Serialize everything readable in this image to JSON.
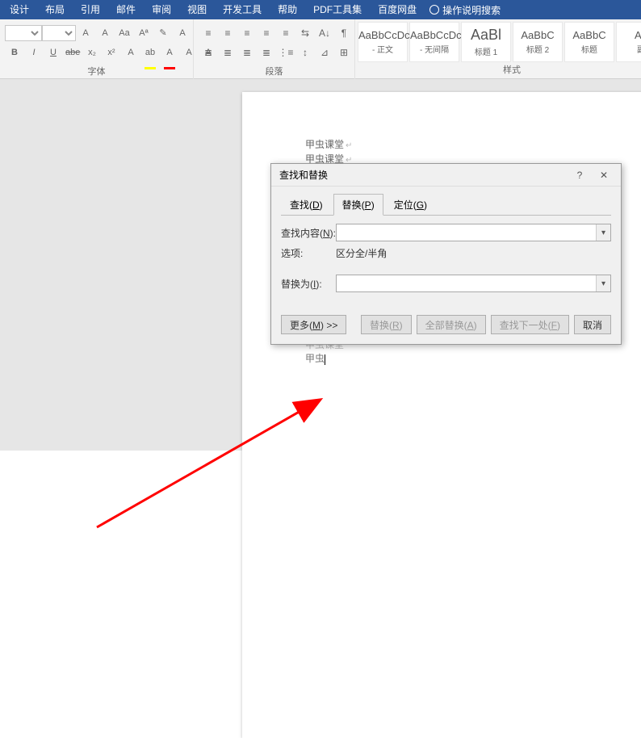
{
  "menu": {
    "items": [
      "设计",
      "布局",
      "引用",
      "邮件",
      "审阅",
      "视图",
      "开发工具",
      "帮助",
      "PDF工具集",
      "百度网盘"
    ],
    "search_hint": "操作说明搜索"
  },
  "ribbon": {
    "font": {
      "label": "字体",
      "btns_row1": [
        "A",
        "A",
        "Aa",
        "Aª",
        "✎",
        "A"
      ],
      "btns_row2": [
        "B",
        "I",
        "U",
        "abe",
        "x₂",
        "x²",
        "A",
        "ab",
        "A",
        "A",
        "A"
      ]
    },
    "paragraph": {
      "label": "段落",
      "btns_row1": [
        "≡",
        "≡",
        "≡",
        "≡",
        "≡",
        "⇆",
        "A↓",
        "¶"
      ],
      "btns_row2": [
        "≣",
        "≣",
        "≣",
        "≣",
        "⋮≡",
        "↕",
        "⊿",
        "⊞"
      ]
    },
    "styles": {
      "label": "样式",
      "items": [
        {
          "preview": "AaBbCcDc",
          "name": "- 正文"
        },
        {
          "preview": "AaBbCcDc",
          "name": "- 无间隔"
        },
        {
          "preview": "AaBl",
          "name": "标题 1"
        },
        {
          "preview": "AaBbC",
          "name": "标题 2"
        },
        {
          "preview": "AaBbC",
          "name": "标题"
        },
        {
          "preview": "Aa",
          "name": "副"
        }
      ]
    }
  },
  "document": {
    "lines": [
      "甲虫课堂",
      "甲虫课堂"
    ],
    "lower_lines": [
      "甲虫课堂",
      "甲虫"
    ]
  },
  "dialog": {
    "title": "查找和替换",
    "tabs": [
      {
        "label": "查找(D)",
        "active": false,
        "accel": "D"
      },
      {
        "label": "替换(P)",
        "active": true,
        "accel": "P"
      },
      {
        "label": "定位(G)",
        "active": false,
        "accel": "G"
      }
    ],
    "find_label": "查找内容(N):",
    "options_label": "选项:",
    "options_value": "区分全/半角",
    "replace_label": "替换为(I):",
    "find_value": "",
    "replace_value": "",
    "buttons": {
      "more": "更多(M) >>",
      "replace": "替换(R)",
      "replace_all": "全部替换(A)",
      "find_next": "查找下一处(F)",
      "cancel": "取消"
    }
  }
}
